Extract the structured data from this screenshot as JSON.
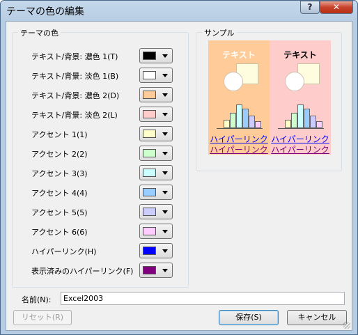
{
  "window": {
    "title": "テーマの色の編集",
    "help_label": "?",
    "close_label": "✕"
  },
  "theme_colors": {
    "group_title": "テーマの色",
    "items": [
      {
        "label": "テキスト/背景: 濃色 1(T)",
        "color": "#000000"
      },
      {
        "label": "テキスト/背景: 淡色 1(B)",
        "color": "#FFFFFF"
      },
      {
        "label": "テキスト/背景: 濃色 2(D)",
        "color": "#FFCC99"
      },
      {
        "label": "テキスト/背景: 淡色 2(L)",
        "color": "#FFCCCC"
      },
      {
        "label": "アクセント 1(1)",
        "color": "#FFFFCC"
      },
      {
        "label": "アクセント 2(2)",
        "color": "#CCFFCC"
      },
      {
        "label": "アクセント 3(3)",
        "color": "#CCFFFF"
      },
      {
        "label": "アクセント 4(4)",
        "color": "#99CCFF"
      },
      {
        "label": "アクセント 5(5)",
        "color": "#CCCCFF"
      },
      {
        "label": "アクセント 6(6)",
        "color": "#FFCCFF"
      },
      {
        "label": "ハイパーリンク(H)",
        "color": "#0000FF"
      },
      {
        "label": "表示済みのハイパーリンク(F)",
        "color": "#800080"
      }
    ]
  },
  "sample": {
    "group_title": "サンプル",
    "dark_panel": {
      "text": "テキスト",
      "link1": "ハイパーリンク",
      "link2": "ハイパーリンク"
    },
    "light_panel": {
      "text": "テキスト",
      "link1": "ハイパーリンク",
      "link2": "ハイパーリンク"
    }
  },
  "name": {
    "label": "名前(N):",
    "value": "Excel2003"
  },
  "buttons": {
    "reset": "リセット(R)",
    "save": "保存(S)",
    "cancel": "キャンセル"
  }
}
